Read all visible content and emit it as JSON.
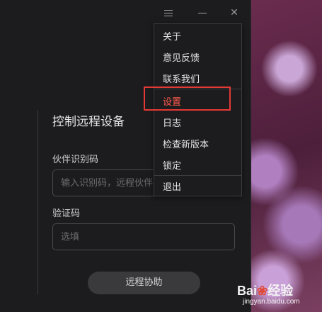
{
  "window": {
    "section_title": "控制远程设备",
    "partner_label": "伙伴识别码",
    "partner_placeholder": "输入识别码，远程伙伴",
    "code_label": "验证码",
    "code_placeholder": "选填",
    "assist_button": "远程协助"
  },
  "titlebar": {
    "menu_icon": "hamburger-menu-icon",
    "minimize_icon": "minimize-icon",
    "close_icon": "close-icon",
    "close_glyph": "✕"
  },
  "dropdown": {
    "items": [
      "关于",
      "意见反馈",
      "联系我们",
      "设置",
      "日志",
      "检查新版本",
      "锁定",
      "退出"
    ],
    "active_item": "设置",
    "active_color": "#ff5a4c"
  },
  "annotation": {
    "box_color": "#e53935"
  },
  "watermark": {
    "brand_left": "Bai",
    "brand_right": "经验",
    "url": "jingyan.baidu.com"
  }
}
